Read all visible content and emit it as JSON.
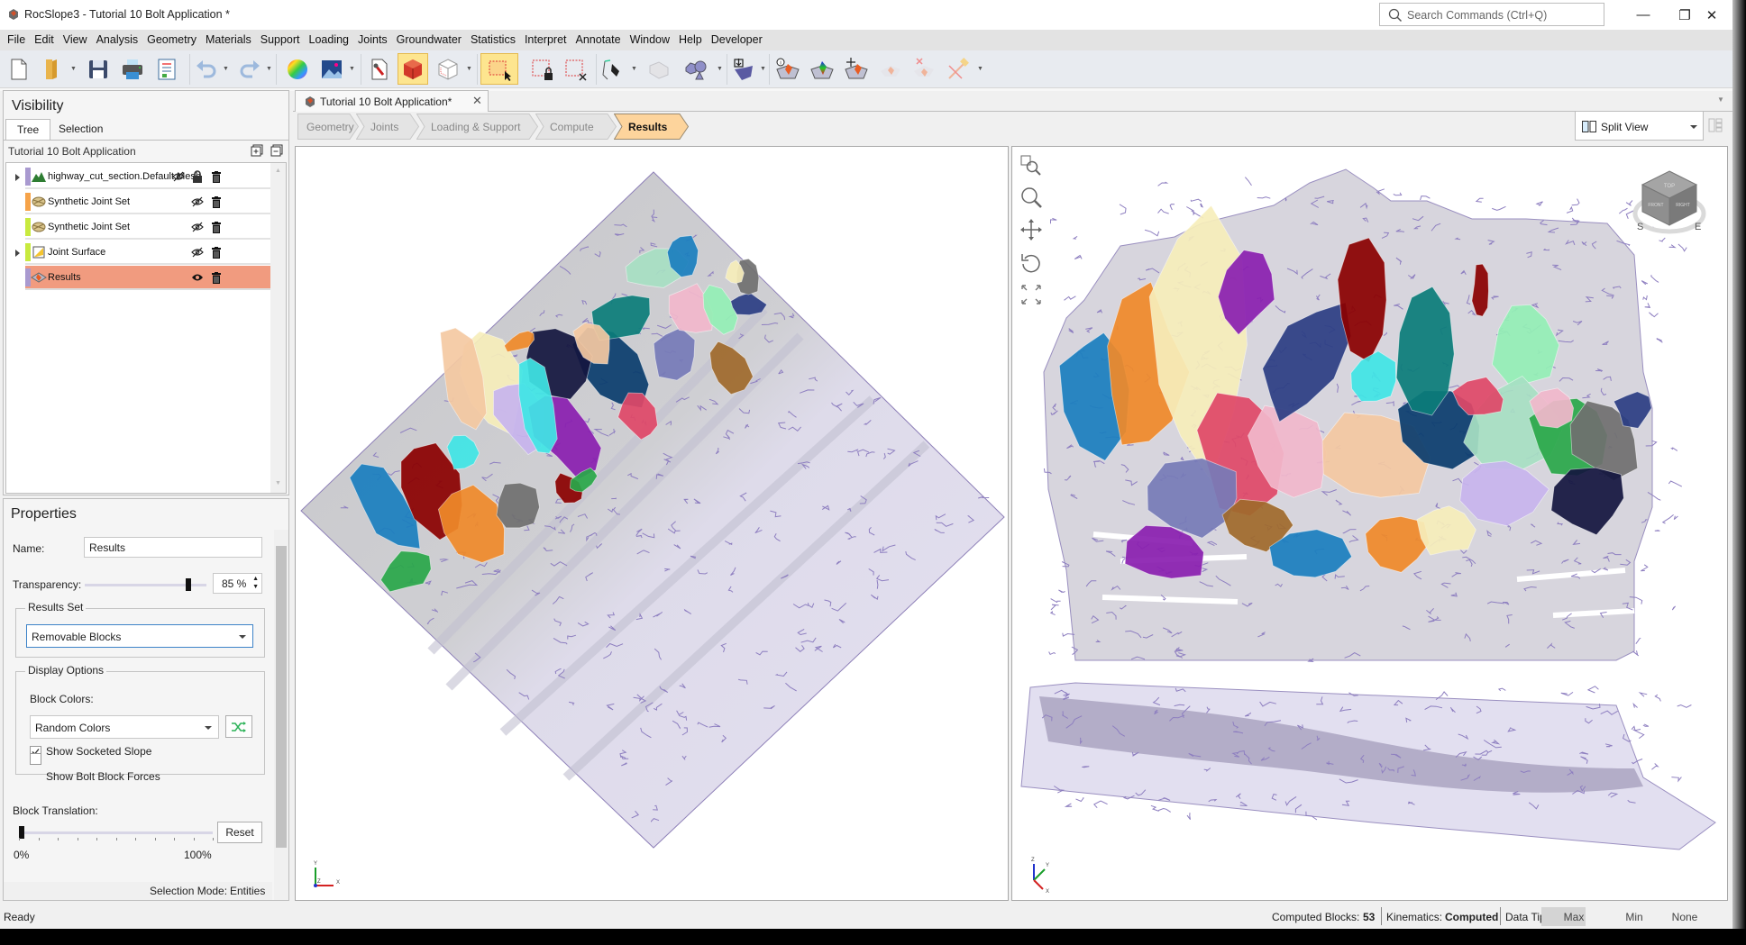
{
  "window": {
    "title": "RocSlope3 - Tutorial 10 Bolt Application *",
    "search_placeholder": "Search Commands (Ctrl+Q)",
    "minimize": "—",
    "restore": "❐",
    "close": "✕"
  },
  "menu": [
    "File",
    "Edit",
    "View",
    "Analysis",
    "Geometry",
    "Materials",
    "Support",
    "Loading",
    "Joints",
    "Groundwater",
    "Statistics",
    "Interpret",
    "Annotate",
    "Window",
    "Help",
    "Developer"
  ],
  "toolbar": {
    "buttons": [
      {
        "name": "new-icon"
      },
      {
        "name": "open-icon"
      },
      {
        "name": "save-icon"
      },
      {
        "name": "print-icon"
      },
      {
        "name": "report-icon"
      },
      {
        "name": "undo-icon"
      },
      {
        "name": "redo-icon"
      },
      {
        "name": "color-wheel-icon"
      },
      {
        "name": "image-icon"
      },
      {
        "name": "properties-icon"
      },
      {
        "name": "solid-block-icon",
        "active": true
      },
      {
        "name": "wireframe-block-icon"
      },
      {
        "name": "box-select-icon",
        "active": true
      },
      {
        "name": "lock-select-icon"
      },
      {
        "name": "clear-select-icon"
      },
      {
        "name": "polyline-pen-icon"
      },
      {
        "name": "surface-icon"
      },
      {
        "name": "boolean-shapes-icon"
      },
      {
        "name": "import-surface-icon"
      },
      {
        "name": "block-info-icon"
      },
      {
        "name": "block-contour-icon"
      },
      {
        "name": "block-move-icon"
      },
      {
        "name": "block-hide-icon"
      },
      {
        "name": "block-delete-icon"
      },
      {
        "name": "bolt-icon"
      }
    ]
  },
  "visibility": {
    "title": "Visibility",
    "tabs": [
      "Tree",
      "Selection"
    ],
    "active_tab": "Tree",
    "project_name": "Tutorial 10 Bolt Application",
    "items": [
      {
        "label": "highway_cut_section.Default.Mesh",
        "color": "#a99ad0",
        "expandable": true,
        "visible": false,
        "locked": true,
        "icon": "mesh-mountain-icon"
      },
      {
        "label": "Synthetic Joint Set",
        "color": "#f6a349",
        "expandable": false,
        "visible": false,
        "icon": "joint-set-icon"
      },
      {
        "label": "Synthetic Joint Set",
        "color": "#c8ea3f",
        "expandable": false,
        "visible": false,
        "icon": "joint-set-icon"
      },
      {
        "label": "Joint Surface",
        "color": "#c8ea3f",
        "expandable": true,
        "visible": false,
        "icon": "joint-surface-icon"
      },
      {
        "label": "Results",
        "color": "#a99ad0",
        "expandable": false,
        "visible": true,
        "selected": true,
        "icon": "results-icon"
      }
    ]
  },
  "properties": {
    "title": "Properties",
    "name_label": "Name:",
    "name_value": "Results",
    "transparency_label": "Transparency:",
    "transparency_value": "85 %",
    "transparency_fraction": 0.85,
    "results_set_label": "Results Set",
    "results_set_value": "Removable Blocks",
    "display_options_label": "Display Options",
    "block_colors_label": "Block Colors:",
    "block_colors_value": "Random Colors",
    "show_socketed_slope_label": "Show Socketed Slope",
    "show_socketed_slope": true,
    "show_bolt_forces_label": "Show Bolt Block Forces",
    "show_bolt_forces": false,
    "block_translation_label": "Block Translation:",
    "block_translation_fraction": 0.0,
    "reset_label": "Reset",
    "min_label": "0%",
    "max_label": "100%",
    "selection_mode_label": "Selection Mode:",
    "selection_mode_value": "Entities"
  },
  "document": {
    "tab_label": "Tutorial 10 Bolt Application*",
    "workflow": [
      "Geometry",
      "Joints",
      "Loading & Support",
      "Compute",
      "Results"
    ],
    "active_step": "Results",
    "view_mode": "Split View"
  },
  "viewports": {
    "left": {
      "axis_labels": [
        "Y",
        "Z",
        "X"
      ]
    },
    "right": {
      "tools": [
        "zoom-window-icon",
        "zoom-icon",
        "pan-icon",
        "rotate-icon",
        "zoom-extents-icon"
      ],
      "nav_cube": {
        "top": "TOP",
        "front": "FRONT",
        "right": "RIGHT",
        "compass": [
          "S",
          "E"
        ]
      },
      "axis_labels": [
        "Z",
        "Y",
        "X"
      ]
    },
    "block_colors": [
      "#1b7fbf",
      "#8b0000",
      "#2aa84a",
      "#f08a2a",
      "#40e6e6",
      "#707070",
      "#f7eebb",
      "#f5c9a2",
      "#c8b5ee",
      "#8a1fb0",
      "#0a3d6e",
      "#14163f",
      "#e04868",
      "#0b7d7a",
      "#777bb8",
      "#f2b8cc",
      "#94f0b6",
      "#a06a2c",
      "#2c3e84",
      "#a8e0c4"
    ]
  },
  "status": {
    "ready": "Ready",
    "computed_blocks_label": "Computed Blocks:",
    "computed_blocks_value": "53",
    "kinematics_label": "Kinematics:",
    "kinematics_value": "Computed",
    "data_tips_label": "Data Tips:",
    "data_tips_options": [
      "Max",
      "Min",
      "None"
    ],
    "data_tips_active": "Max"
  }
}
